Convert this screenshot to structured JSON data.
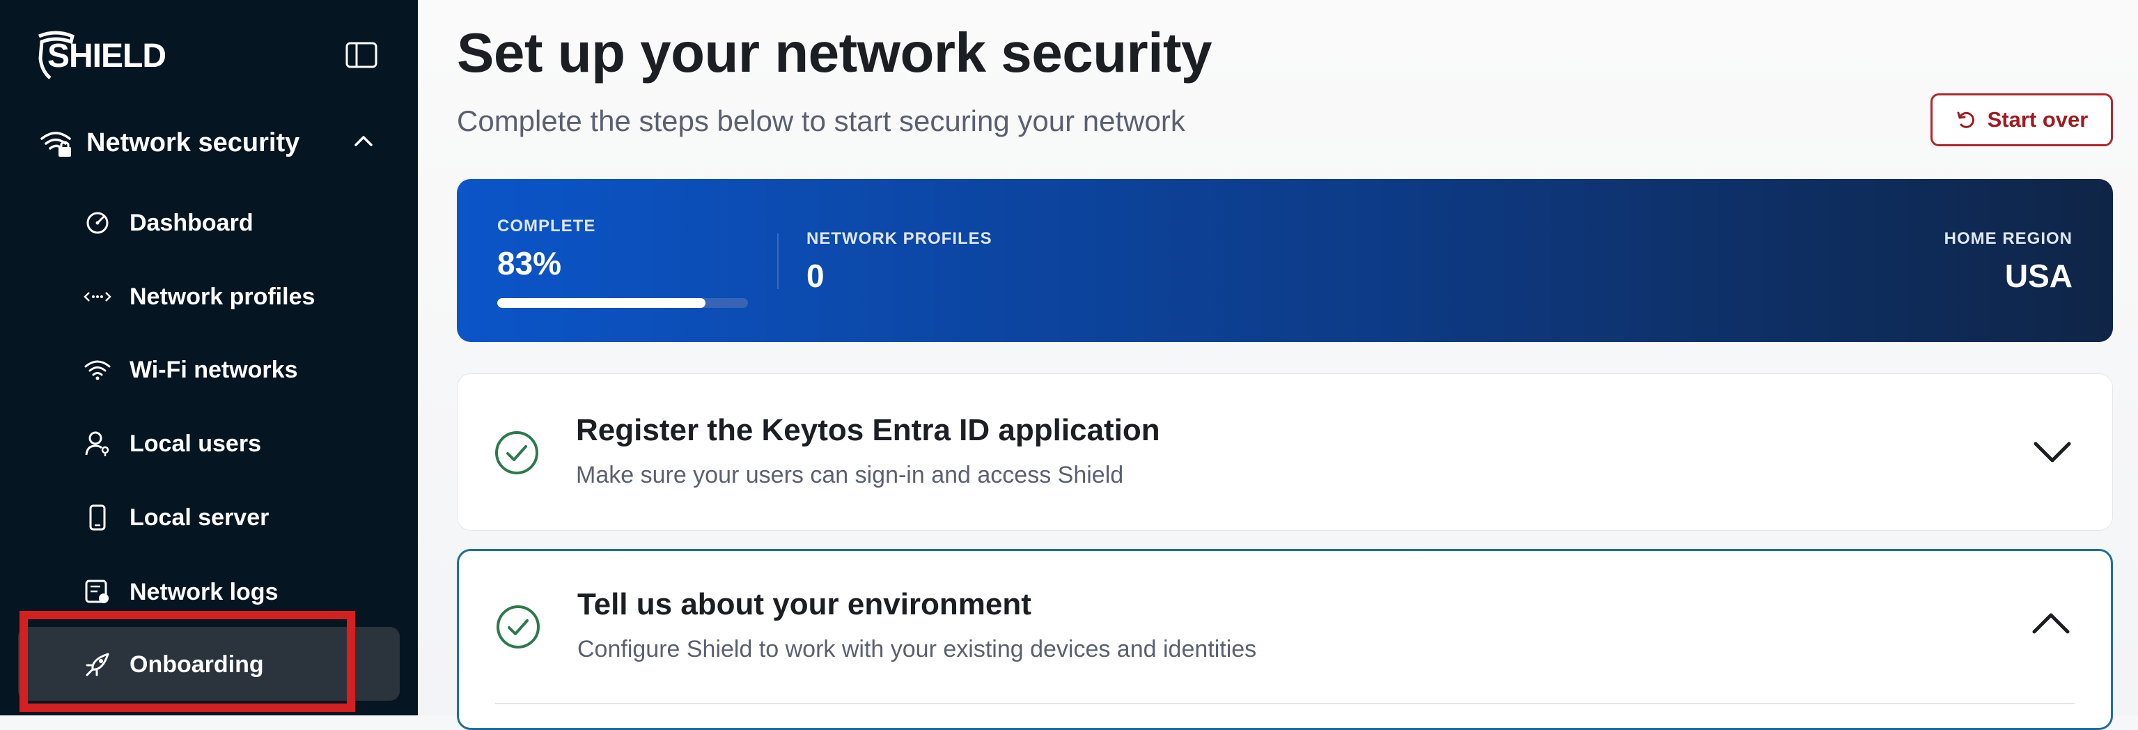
{
  "brand": {
    "logo_text": "SHIELD"
  },
  "sidebar": {
    "section_label": "Network security",
    "items": [
      {
        "label": "Dashboard",
        "icon": "gauge-icon"
      },
      {
        "label": "Network profiles",
        "icon": "dots-arrows-icon"
      },
      {
        "label": "Wi-Fi networks",
        "icon": "wifi-icon"
      },
      {
        "label": "Local users",
        "icon": "user-key-icon"
      },
      {
        "label": "Local server",
        "icon": "phone-device-icon"
      },
      {
        "label": "Network logs",
        "icon": "log-icon"
      },
      {
        "label": "Onboarding",
        "icon": "rocket-icon",
        "active": true
      }
    ]
  },
  "header": {
    "title": "Set up your network security",
    "subtitle": "Complete the steps below to start securing your network",
    "start_over_label": "Start over"
  },
  "stats": {
    "complete_label": "COMPLETE",
    "complete_value": "83%",
    "complete_fraction": 0.83,
    "profiles_label": "NETWORK PROFILES",
    "profiles_value": "0",
    "region_label": "HOME REGION",
    "region_value": "USA"
  },
  "steps": [
    {
      "title": "Register the Keytos Entra ID application",
      "description": "Make sure your users can sign-in and access Shield",
      "status": "complete",
      "expanded": false
    },
    {
      "title": "Tell us about your environment",
      "description": "Configure Shield to work with your existing devices and identities",
      "status": "complete",
      "expanded": true
    }
  ],
  "colors": {
    "sidebar_bg": "#051522",
    "active_item_bg": "#2b333d",
    "highlight": "#d42020",
    "banner_start": "#0b55c9",
    "banner_end": "#0f2547",
    "check_green": "#2c7a4b",
    "danger": "#b3262b"
  }
}
